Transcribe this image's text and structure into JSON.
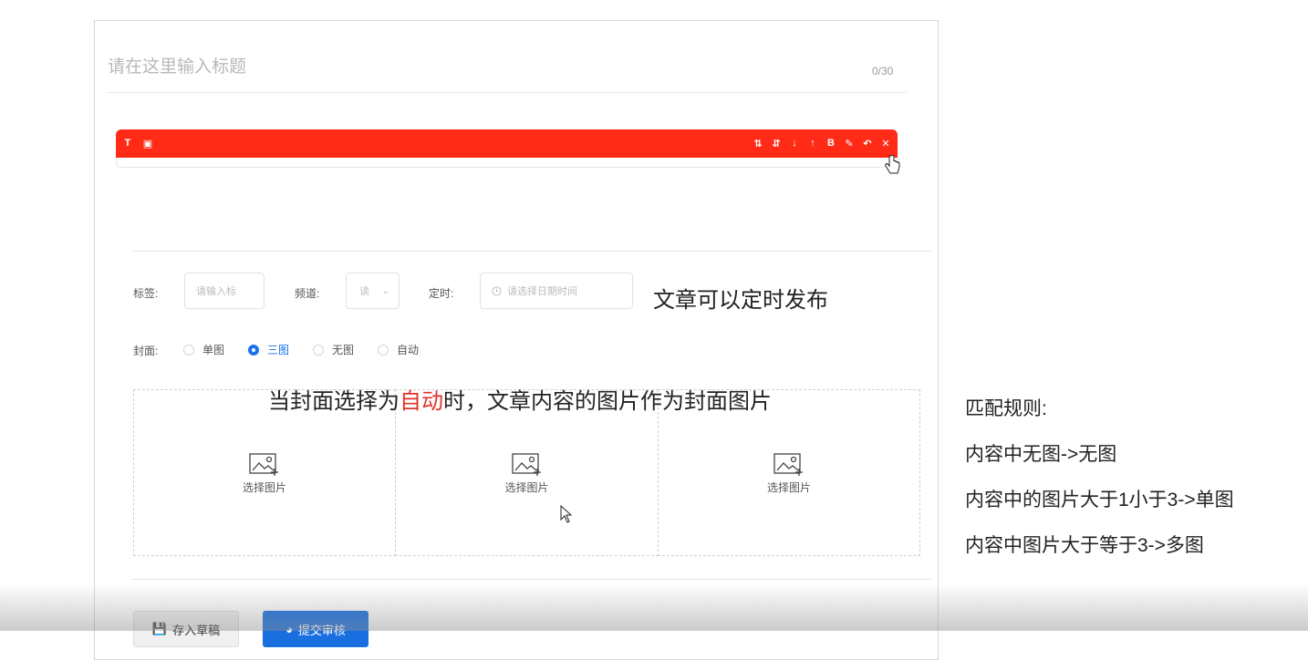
{
  "title_field": {
    "placeholder": "请在这里输入标题",
    "counter": "0/30"
  },
  "toolbar": {
    "left_buttons": [
      {
        "icon": "text-icon",
        "glyph": "T"
      },
      {
        "icon": "image-icon",
        "glyph": "▣"
      }
    ],
    "right_buttons": [
      {
        "icon": "sort-asc-icon",
        "glyph": "⇅"
      },
      {
        "icon": "sort-desc-icon",
        "glyph": "⇵"
      },
      {
        "icon": "arrow-down-icon",
        "glyph": "↓"
      },
      {
        "icon": "arrow-up-icon",
        "glyph": "↑"
      },
      {
        "icon": "bold-icon",
        "glyph": "B"
      },
      {
        "icon": "edit-icon",
        "glyph": "✎"
      },
      {
        "icon": "undo-icon",
        "glyph": "↶"
      },
      {
        "icon": "close-icon",
        "glyph": "✕"
      }
    ],
    "color": "#ff2b17"
  },
  "form": {
    "tags_label": "标签:",
    "tags_placeholder": "请输入标",
    "channel_label": "频道:",
    "channel_value": "读",
    "schedule_label": "定时:",
    "schedule_placeholder": "请选择日期时间",
    "cover_label": "封面:",
    "cover_options": [
      {
        "label": "单图",
        "selected": false
      },
      {
        "label": "三图",
        "selected": true
      },
      {
        "label": "无图",
        "selected": false
      },
      {
        "label": "自动",
        "selected": false
      }
    ]
  },
  "annotations": {
    "schedule_note": "文章可以定时发布",
    "cover_note_prefix": "当封面选择为",
    "cover_note_highlight": "自动",
    "cover_note_suffix": "时，文章内容的图片作为封面图片"
  },
  "cover_slots": [
    {
      "label": "选择图片"
    },
    {
      "label": "选择图片"
    },
    {
      "label": "选择图片"
    }
  ],
  "buttons": {
    "save_draft": "存入草稿",
    "submit": "提交审核"
  },
  "rules": {
    "heading": "匹配规则:",
    "lines": [
      "内容中无图->无图",
      "内容中的图片大于1小于3->单图",
      "内容中图片大于等于3->多图"
    ]
  },
  "colors": {
    "accent": "#1a73e8",
    "toolbar": "#ff2b17",
    "highlight": "#e0332a"
  }
}
